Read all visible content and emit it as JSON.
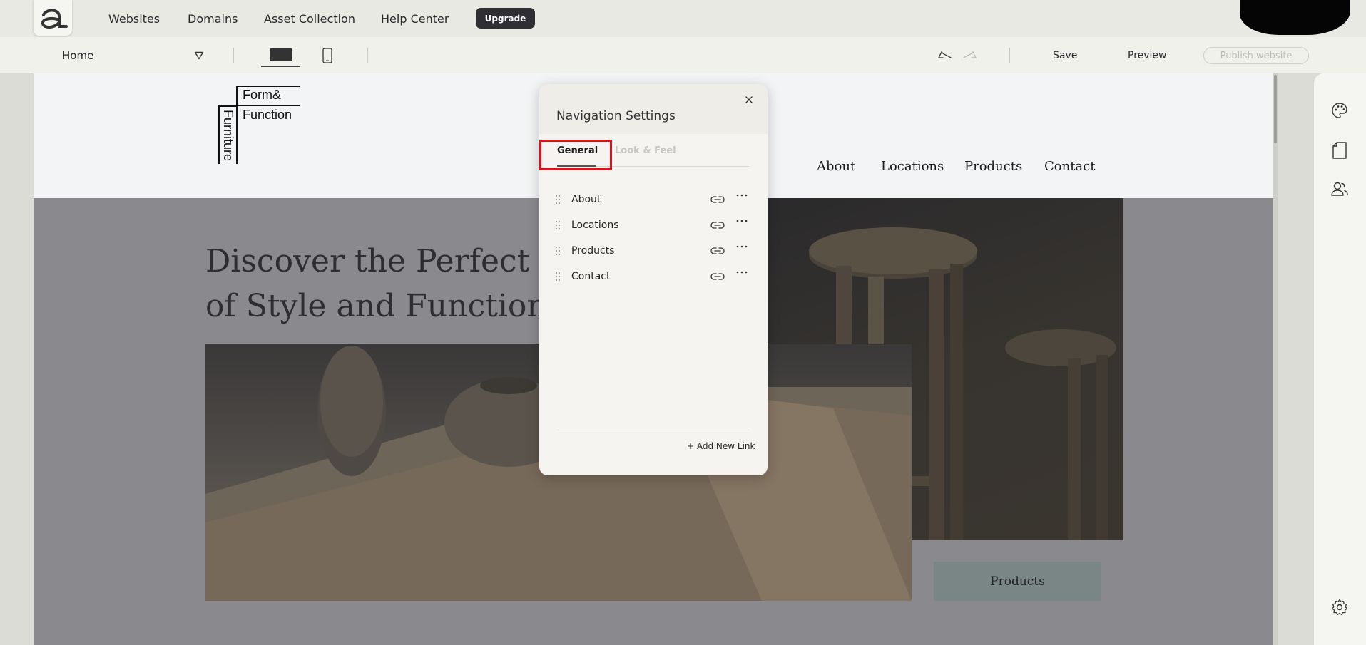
{
  "topbar": {
    "nav": [
      "Websites",
      "Domains",
      "Asset Collection",
      "Help Center"
    ],
    "upgrade_label": "Upgrade"
  },
  "toolbar": {
    "page_select_value": "Home",
    "save_label": "Save",
    "preview_label": "Preview",
    "publish_label": "Publish website"
  },
  "site": {
    "logo_lines": [
      "Form&",
      "Function",
      "Furniture"
    ],
    "nav": [
      "About",
      "Locations",
      "Products",
      "Contact"
    ],
    "hero_line1": "Discover the Perfect F",
    "hero_line2": "of Style and Function",
    "products_button": "Products"
  },
  "nav_panel": {
    "title": "Navigation Settings",
    "tabs": [
      "General",
      "Look & Feel"
    ],
    "active_tab": "General",
    "links": [
      "About",
      "Locations",
      "Products",
      "Contact"
    ],
    "add_link_label": "+ Add New Link"
  },
  "colors": {
    "accent_dark": "#2e2e33",
    "highlight": "#e0101a",
    "canvas_overlay": "#8a8a8e"
  },
  "icons": {
    "right_rail": [
      "palette-icon",
      "page-icon",
      "users-icon",
      "settings-icon"
    ]
  }
}
